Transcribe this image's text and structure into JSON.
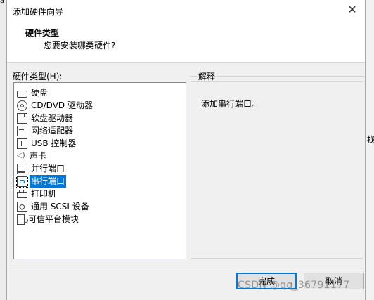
{
  "window": {
    "title": "添加硬件向导",
    "close_glyph": "✕"
  },
  "header": {
    "title": "硬件类型",
    "subtitle": "您要安装哪类硬件?"
  },
  "list": {
    "label": "硬件类型(H):",
    "items": [
      {
        "label": "硬盘",
        "icon": "hard-disk-icon",
        "selected": false
      },
      {
        "label": "CD/DVD 驱动器",
        "icon": "cd-dvd-icon",
        "selected": false
      },
      {
        "label": "软盘驱动器",
        "icon": "floppy-icon",
        "selected": false
      },
      {
        "label": "网络适配器",
        "icon": "network-adapter-icon",
        "selected": false
      },
      {
        "label": "USB 控制器",
        "icon": "usb-icon",
        "selected": false
      },
      {
        "label": "声卡",
        "icon": "sound-card-icon",
        "selected": false
      },
      {
        "label": "并行端口",
        "icon": "parallel-port-icon",
        "selected": false
      },
      {
        "label": "串行端口",
        "icon": "serial-port-icon",
        "selected": true
      },
      {
        "label": "打印机",
        "icon": "printer-icon",
        "selected": false
      },
      {
        "label": "通用 SCSI 设备",
        "icon": "scsi-icon",
        "selected": false
      },
      {
        "label": "可信平台模块",
        "icon": "tpm-icon",
        "selected": false
      }
    ]
  },
  "description": {
    "label": "解释",
    "text": "添加串行端口。"
  },
  "buttons": {
    "finish": "完成",
    "cancel": "取消"
  },
  "watermark": "CSDN @qq_36791177",
  "stray": {
    "top_left": "à",
    "right_edge": "找"
  },
  "colors": {
    "selection": "#0078d7",
    "dialog_bg": "#f0f0f0",
    "header_bg": "#ffffff"
  }
}
